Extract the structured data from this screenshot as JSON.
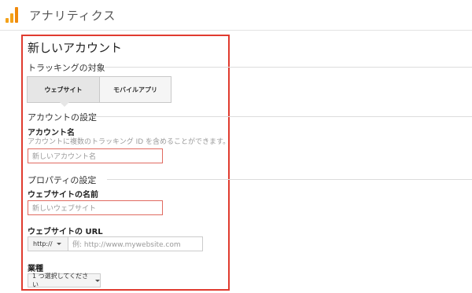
{
  "header": {
    "app_title": "アナリティクス",
    "logo_icon": "analytics-logo-icon",
    "logo_color": "#f4a21a"
  },
  "form": {
    "title": "新しいアカウント",
    "tracking_section": "トラッキングの対象",
    "tracking_options": [
      "ウェブサイト",
      "モバイルアプリ"
    ],
    "account_section": "アカウントの設定",
    "account_name_label": "アカウント名",
    "account_name_hint": "アカウントに複数のトラッキング ID を含めることができます。",
    "account_name_placeholder": "新しいアカウント名",
    "property_section": "プロパティの設定",
    "website_name_label": "ウェブサイトの名前",
    "website_name_placeholder": "新しいウェブサイト",
    "website_url_label": "ウェブサイトの URL",
    "url_protocol": "http://",
    "url_placeholder": "例: http://www.mywebsite.com",
    "industry_label": "業種",
    "industry_select": "1 つ選択してください",
    "highlight_color": "#e03b2f"
  }
}
